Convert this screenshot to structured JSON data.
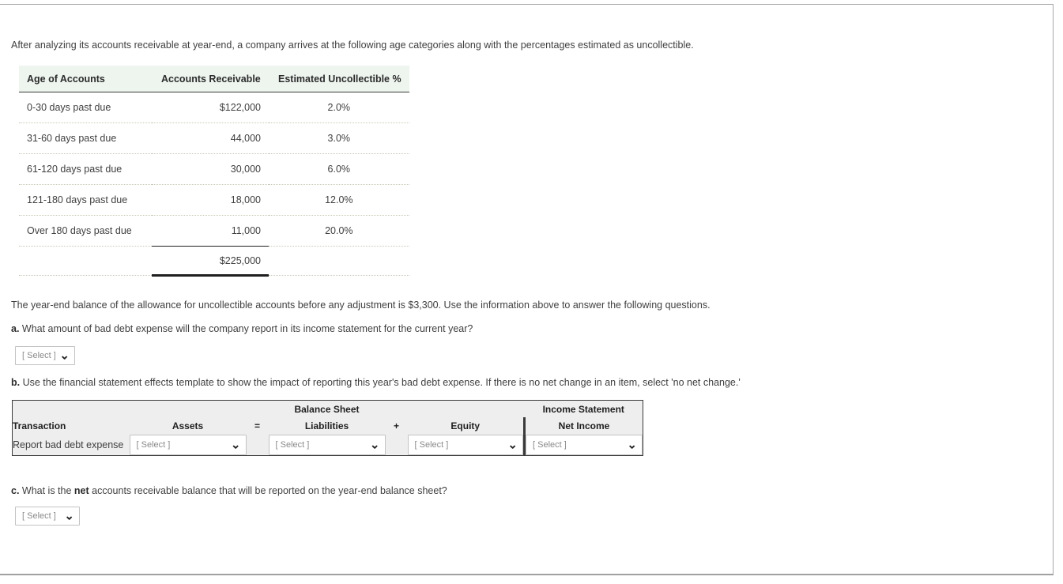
{
  "intro": "After analyzing its accounts receivable at year-end, a company arrives at the following age categories along with the percentages estimated as uncollectible.",
  "aging_table": {
    "headers": [
      "Age of Accounts",
      "Accounts Receivable",
      "Estimated Uncollectible %"
    ],
    "rows": [
      {
        "age": "0-30 days past due",
        "receivable": "$122,000",
        "pct": "2.0%"
      },
      {
        "age": "31-60 days past due",
        "receivable": "44,000",
        "pct": "3.0%"
      },
      {
        "age": "61-120 days past due",
        "receivable": "30,000",
        "pct": "6.0%"
      },
      {
        "age": "121-180 days past due",
        "receivable": "18,000",
        "pct": "12.0%"
      },
      {
        "age": "Over 180 days past due",
        "receivable": "11,000",
        "pct": "20.0%"
      }
    ],
    "total": {
      "age": "",
      "receivable": "$225,000",
      "pct": ""
    }
  },
  "mid_text": "The year-end balance of the allowance for uncollectible accounts before any adjustment is $3,300. Use the information above to answer the following questions.",
  "question_a": {
    "prefix": "a.",
    "text": " What amount of bad debt expense will the company report in its income statement for the current year?",
    "select_value": "[ Select ]"
  },
  "question_b": {
    "prefix": "b.",
    "text": " Use the financial statement effects template to show the impact of reporting this year's bad debt expense. If there is no net change in an item, select 'no net change.'"
  },
  "fse_table": {
    "group_balance_sheet": "Balance Sheet",
    "group_income_statement": "Income Statement",
    "col_transaction": "Transaction",
    "col_assets": "Assets",
    "op_equals": "=",
    "col_liabilities": "Liabilities",
    "op_plus": "+",
    "col_equity": "Equity",
    "col_net_income": "Net Income",
    "row_label": "Report bad debt expense",
    "select_assets": "[ Select ]",
    "select_liabilities": "[ Select ]",
    "select_equity": "[ Select ]",
    "select_net_income": "[ Select ]"
  },
  "question_c": {
    "prefix": "c.",
    "text_before": " What is the ",
    "bold": "net",
    "text_after": " accounts receivable balance that will be reported on the year-end balance sheet?",
    "select_value": "[ Select ]"
  },
  "icons": {
    "chevron": "chevron-down-icon"
  },
  "colors": {
    "header_green": "#eef5ef",
    "header_gray": "#eeeeee",
    "border_dark": "#3a3a3a",
    "text": "#3f3f3f"
  }
}
